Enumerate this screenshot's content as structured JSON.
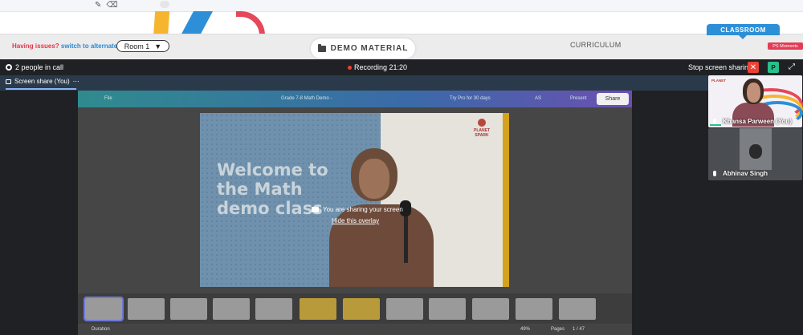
{
  "header": {
    "issues_text": "Having issues?",
    "alternate_link": "switch to alternate room",
    "room_value": "Room 1",
    "demo_material": "DEMO MATERIAL",
    "curriculum": "CURRICULUM",
    "classroom": "CLASSROOM",
    "ps_moments": "PS Moments"
  },
  "meet": {
    "people_in_call": "2 people in call",
    "recording": "Recording 21:20",
    "stop_sharing": "Stop screen sharing",
    "close_symbol": "✕",
    "participant_initial": "P",
    "tab_label": "Screen share (You)",
    "tab_more": "⋯"
  },
  "canva": {
    "file": "File",
    "doc_title": "Grade 7-8 Math Demo -",
    "try_pro": "Try Pro for 30 days",
    "avatars": "AS",
    "present": "Present",
    "share": "Share",
    "duration": "Duration",
    "zoom": "49%",
    "pages": "Pages",
    "page_count": "1 / 47"
  },
  "slide": {
    "title": "Welcome to\nthe Math\ndemo class",
    "logo_line1": "PLANET",
    "logo_line2": "SPARK"
  },
  "overlay": {
    "message": "You are sharing your screen",
    "hide_link": "Hide this overlay"
  },
  "participants": [
    {
      "name": "Khansa Parween (You)"
    },
    {
      "name": "Abhinav Singh"
    }
  ],
  "icons": {
    "gear": "gear-icon",
    "rec": "record-dot-icon",
    "expand": "expand-icon",
    "mic": "microphone-icon",
    "monitor": "monitor-icon",
    "folder": "folder-icon"
  },
  "colors": {
    "classroom_blue": "#2d8fd6",
    "recording_red": "#ea4335",
    "accent_green": "#27c18b",
    "issues_red": "#e8334a"
  }
}
